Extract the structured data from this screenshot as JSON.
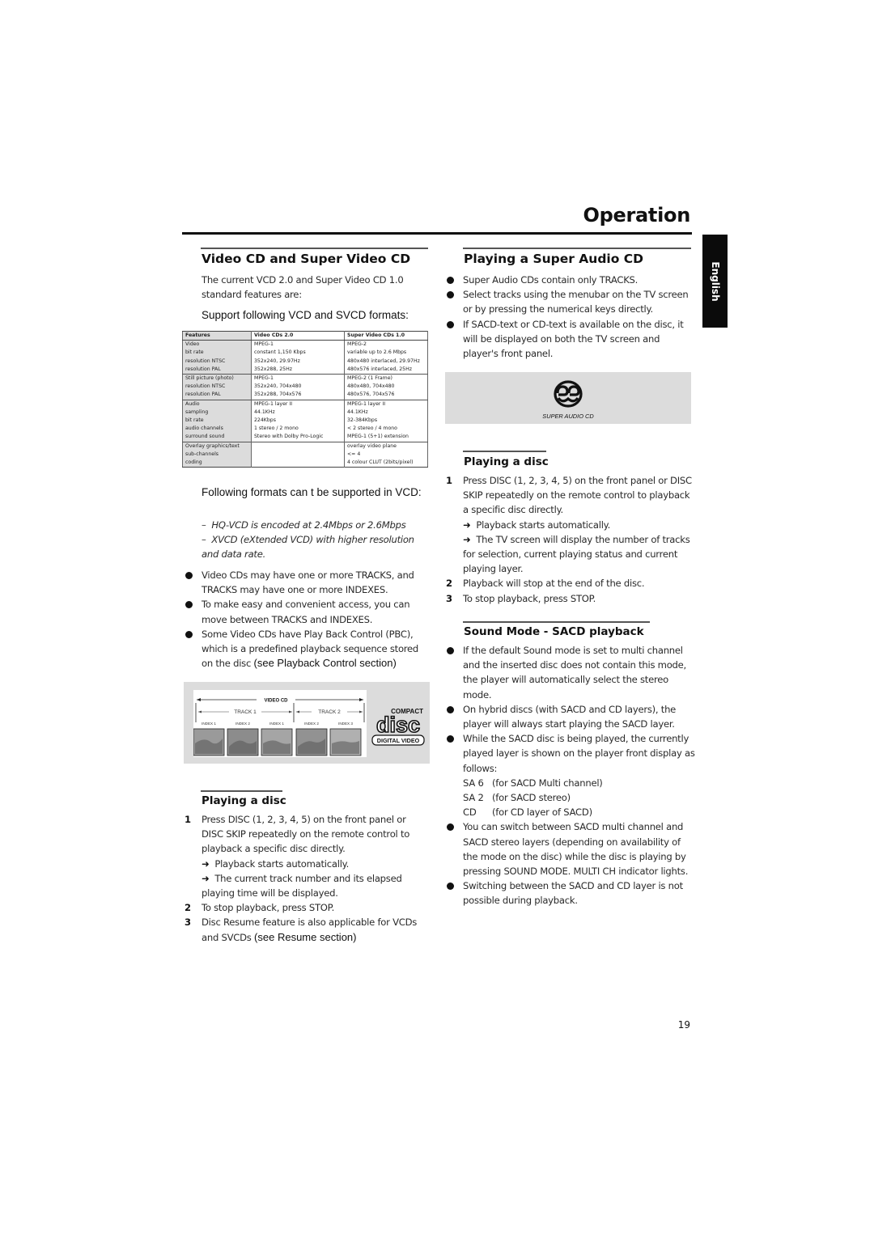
{
  "page": {
    "title": "Operation",
    "language_tab": "English",
    "page_number": "19"
  },
  "left": {
    "section1": {
      "title": "Video CD and Super Video CD",
      "intro": "The current VCD 2.0 and Super Video CD 1.0 standard features are:",
      "support_line": "Support following VCD and SVCD formats:",
      "table": {
        "headers": [
          "Features",
          "Video CDs 2.0",
          "Super Video CDs 1.0"
        ],
        "groups": [
          [
            [
              "Video",
              "MPEG-1",
              "MPEG-2"
            ],
            [
              "bit rate",
              "constant 1,150 Kbps",
              "variable up to 2.6 Mbps"
            ],
            [
              "resolution NTSC",
              "352x240, 29.97Hz",
              "480x480 interlaced, 29.97Hz"
            ],
            [
              "resolution PAL",
              "352x288, 25Hz",
              "480x576 interlaced, 25Hz"
            ]
          ],
          [
            [
              "Still picture (photo)",
              "MPEG-1",
              "MPEG-2 (1 Frame)"
            ],
            [
              "resolution NTSC",
              "352x240, 704x480",
              "480x480, 704x480"
            ],
            [
              "resolution PAL",
              "352x288, 704x576",
              "480x576, 704x576"
            ]
          ],
          [
            [
              "Audio",
              "MPEG-1 layer II",
              "MPEG-1 layer II"
            ],
            [
              "sampling",
              "44.1KHz",
              "44.1KHz"
            ],
            [
              "bit rate",
              "224Kbps",
              "32-384Kbps"
            ],
            [
              "audio channels",
              "1 stereo / 2 mono",
              "< 2 stereo / 4 mono"
            ],
            [
              "surround sound",
              "Stereo with Dolby Pro-Logic",
              "MPEG-1 (5+1) extension"
            ]
          ],
          [
            [
              "Overlay graphics/text",
              "",
              "overlay video plane"
            ],
            [
              "sub-channels",
              "",
              "<= 4"
            ],
            [
              "coding",
              "",
              "4 colour CLUT (2bits/pixel)"
            ]
          ]
        ]
      },
      "unsupported_line": "Following formats can t be supported in VCD:",
      "unsupported": [
        "HQ-VCD is encoded at 2.4Mbps or 2.6Mbps",
        "XVCD (eXtended VCD) with higher resolution and data rate."
      ],
      "dash": "–",
      "bullets": [
        {
          "text": "Video CDs may have one or more TRACKS, and TRACKS may have one or more INDEXES.",
          "extra": ""
        },
        {
          "text": "To make easy and convenient access, you can move between TRACKS and INDEXES.",
          "extra": ""
        },
        {
          "text": "Some Video CDs have Play Back Control (PBC), which is a predefined playback sequence stored on the disc ",
          "extra": "(see Playback Control section)"
        }
      ],
      "figure": {
        "video_cd": "VIDEO CD",
        "track1": "TRACK 1",
        "track2": "TRACK 2",
        "indexes": [
          "INDEX 1",
          "INDEX 2",
          "INDEX 1",
          "INDEX 2",
          "INDEX 3"
        ],
        "logo_compact": "COMPACT",
        "logo_disc": "disc",
        "logo_digital_video": "DIGITAL VIDEO"
      }
    },
    "section2": {
      "title": "Playing a disc",
      "steps": [
        {
          "num": "1",
          "text": "Press DISC (1, 2, 3, 4, 5) on the front panel or DISC SKIP repeatedly on the remote control to playback a specific disc directly."
        },
        {
          "num": "",
          "arrow": "➜",
          "text": "Playback starts automatically."
        },
        {
          "num": "",
          "arrow": "➜",
          "text": "The current track number and its elapsed playing time will be displayed."
        },
        {
          "num": "2",
          "text": "To stop playback, press STOP."
        },
        {
          "num": "3",
          "text": "Disc Resume feature is also applicable for VCDs and SVCDs ",
          "extra": "(see  Resume  section)"
        }
      ]
    }
  },
  "right": {
    "section1": {
      "title": "Playing a Super Audio CD",
      "bullets": [
        "Super Audio CDs contain only TRACKS.",
        "Select tracks using the menubar on the TV screen or by pressing the numerical keys directly.",
        "If SACD-text or CD-text is available on the disc, it will be displayed on both the TV screen and player's front panel."
      ],
      "logo_label": "SUPER AUDIO CD"
    },
    "section2": {
      "title": "Playing a disc",
      "steps": [
        {
          "num": "1",
          "text": "Press DISC (1, 2, 3, 4, 5) on the front panel or DISC SKIP repeatedly on the remote control to playback a specific disc directly."
        },
        {
          "num": "",
          "arrow": "➜",
          "text": "Playback starts automatically."
        },
        {
          "num": "",
          "arrow": "➜",
          "text": "The TV screen will display the number of tracks for selection, current playing status and current playing layer."
        },
        {
          "num": "2",
          "text": "Playback will stop at the end of the disc."
        },
        {
          "num": "3",
          "text": "To stop playback, press STOP."
        }
      ]
    },
    "section3": {
      "title": "Sound Mode - SACD playback",
      "bullets": [
        "If the default Sound mode is set to multi channel and the inserted disc does not contain this mode, the player will automatically select the stereo mode.",
        "On hybrid discs (with SACD and CD layers), the player will always start playing the SACD layer.",
        "While the SACD disc is being played, the currently played layer is shown on the player front display as follows:"
      ],
      "display_modes": [
        {
          "code": "SA 6",
          "desc": "(for SACD Multi channel)"
        },
        {
          "code": "SA 2",
          "desc": "(for SACD stereo)"
        },
        {
          "code": "CD",
          "desc": "(for CD layer of SACD)"
        }
      ],
      "bullets_after": [
        "You can switch between SACD multi channel and SACD stereo layers (depending on availability of the mode on the disc) while the disc is playing by pressing SOUND MODE. MULTI CH indicator lights.",
        "Switching between the SACD and CD layer is not possible during playback."
      ]
    }
  }
}
